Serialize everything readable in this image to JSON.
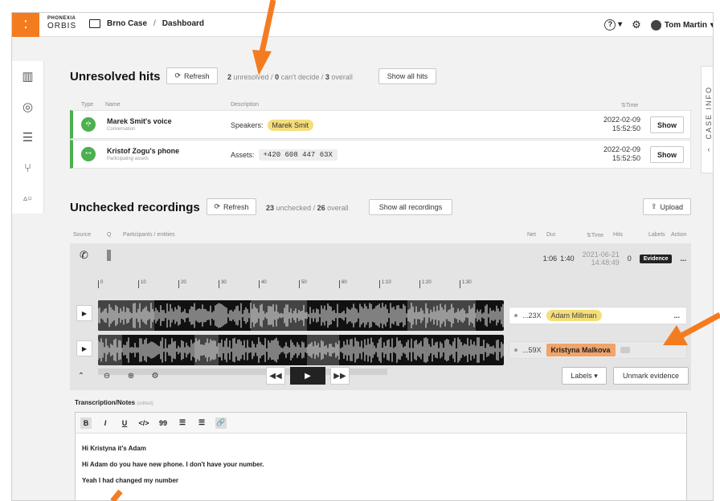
{
  "topbar": {
    "brand_top": "PHONEXIA",
    "brand_bottom": "ORBIS",
    "case": "Brno Case",
    "sep": "/",
    "page": "Dashboard",
    "user": "Tom Martin"
  },
  "case_info": "CASE INFO",
  "hits": {
    "title": "Unresolved hits",
    "refresh": "Refresh",
    "count_unresolved": "2",
    "label_unresolved": "unresolved /",
    "count_cant": "0",
    "label_cant": "can't decide /",
    "count_overall": "3",
    "label_overall": "overall",
    "show_all": "Show all hits",
    "col_type": "Type",
    "col_name": "Name",
    "col_desc": "Description",
    "col_time": "Time",
    "rows": [
      {
        "name": "Marek Smit's voice",
        "sub": "Conversation",
        "desc_label": "Speakers:",
        "desc_value": "Marek Smit",
        "date": "2022-02-09",
        "time": "15:52:50",
        "show": "Show"
      },
      {
        "name": "Kristof Zogu's phone",
        "sub": "Participating assets",
        "desc_label": "Assets:",
        "desc_value": "+420 608 447 63X",
        "date": "2022-02-09",
        "time": "15:52:50",
        "show": "Show"
      }
    ]
  },
  "recordings": {
    "title": "Unchecked recordings",
    "refresh": "Refresh",
    "count_unchecked": "23",
    "label_unchecked": "unchecked /",
    "count_overall": "26",
    "label_overall": "overall",
    "show_all": "Show all recordings",
    "upload": "Upload",
    "col_source": "Source",
    "col_q": "Q",
    "col_participants": "Participants / entities",
    "col_net": "Net",
    "col_dur": "Dur.",
    "col_time": "Time",
    "col_hits": "Hits",
    "col_labels": "Labels",
    "col_action": "Action",
    "row": {
      "net": "1:06",
      "dur": "1:40",
      "date": "2021-06-21",
      "time": "14:48:49",
      "hits": "0",
      "label": "Evidence",
      "action": "..."
    },
    "ruler": [
      "0",
      "10",
      "20",
      "30",
      "40",
      "50",
      "60",
      "1:10",
      "1:20",
      "1:30"
    ],
    "speakers": [
      {
        "count": "...23X",
        "name": "Adam Millman"
      },
      {
        "count": "...59X",
        "name": "Kristyna Malkova"
      }
    ],
    "more": "...",
    "labels_btn": "Labels",
    "unmark_btn": "Unmark evidence"
  },
  "notes": {
    "title": "Transcription/Notes",
    "edited": "(edited)",
    "toolbar": [
      "B",
      "I",
      "U",
      "</>",
      "99",
      "list-ul",
      "list-ol",
      "link"
    ],
    "lines": [
      "Hi Kristyna it's Adam",
      "Hi Adam do you have new phone. I don't have your number.",
      "Yeah I had changed my number"
    ]
  },
  "colors": {
    "accent": "#f47c20",
    "hit_green": "#4caf50",
    "speaker_yellow": "#f5dd7a",
    "speaker_orange": "#f0a46a"
  }
}
